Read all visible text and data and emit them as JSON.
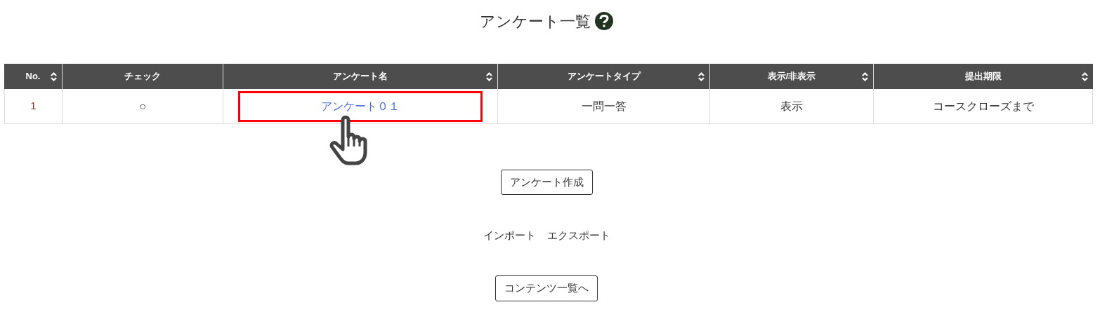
{
  "title": "アンケート一覧",
  "table": {
    "columns": [
      {
        "label": "No.",
        "sortable": true
      },
      {
        "label": "チェック",
        "sortable": false
      },
      {
        "label": "アンケート名",
        "sortable": true
      },
      {
        "label": "アンケートタイプ",
        "sortable": true
      },
      {
        "label": "表示/非表示",
        "sortable": true
      },
      {
        "label": "提出期限",
        "sortable": true
      }
    ],
    "rows": [
      {
        "cells": [
          {
            "kind": "number",
            "text": "1",
            "highlighted": false
          },
          {
            "kind": "text",
            "text": "○",
            "highlighted": false
          },
          {
            "kind": "link",
            "text": "アンケート０１",
            "highlighted": true
          },
          {
            "kind": "text",
            "text": "一問一答",
            "highlighted": false
          },
          {
            "kind": "text",
            "text": "表示",
            "highlighted": false
          },
          {
            "kind": "text",
            "text": "コースクローズまで",
            "highlighted": false
          }
        ]
      }
    ]
  },
  "create_button": "アンケート作成",
  "links": [
    "インポート",
    "エクスポート"
  ],
  "back_button": "コンテンツ一覧へ"
}
